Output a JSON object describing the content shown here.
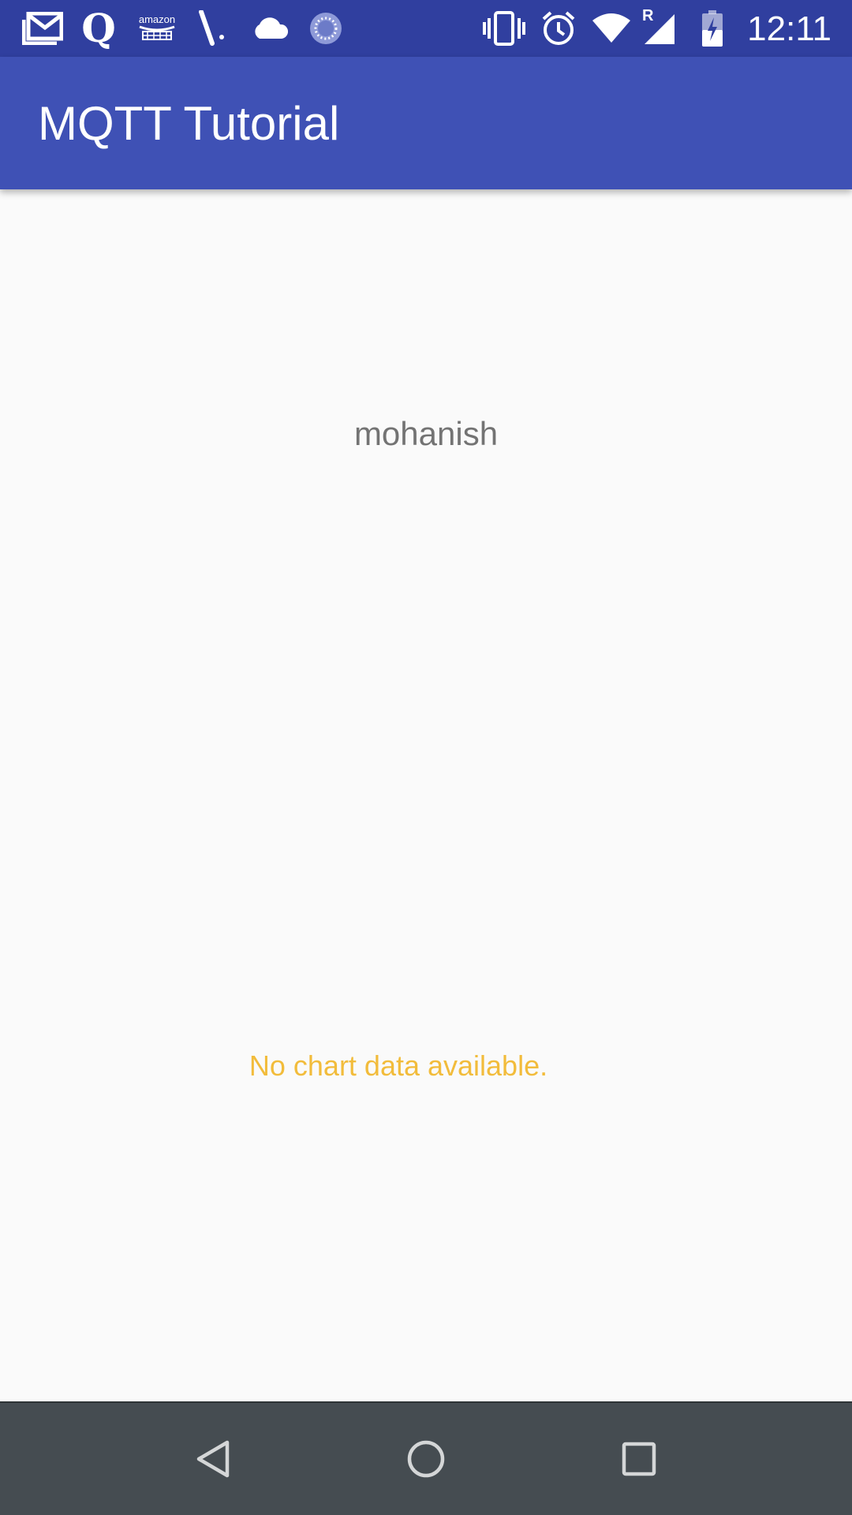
{
  "status_bar": {
    "time": "12:11",
    "left_icons": [
      "gmail-icon",
      "quora-icon",
      "amazon-icon",
      "cricket-icon",
      "cloud-icon",
      "sync-icon"
    ],
    "right_icons": [
      "vibrate-icon",
      "alarm-icon",
      "wifi-icon",
      "signal-icon",
      "battery-charging-icon"
    ],
    "amazon_label": "amazon",
    "quora_glyph": "Q",
    "roaming_label": "R",
    "bar_color": "#303f9f"
  },
  "app_bar": {
    "title": "MQTT Tutorial",
    "color": "#3f51b5"
  },
  "content": {
    "username": "mohanish",
    "chart": {
      "empty_message": "No chart data available.",
      "empty_message_color": "#f2bc3b"
    }
  },
  "nav_bar": {
    "buttons": [
      "back-icon",
      "home-icon",
      "recents-icon"
    ],
    "color": "#454c51"
  }
}
